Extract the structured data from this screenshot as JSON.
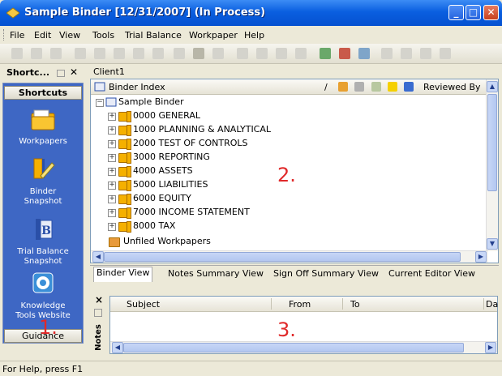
{
  "window": {
    "title": "Sample Binder  [12/31/2007] (In Process)"
  },
  "menu": [
    "File",
    "Edit",
    "View",
    "Tools",
    "Trial Balance",
    "Workpaper",
    "Help"
  ],
  "shortcuts_panel": {
    "header": "Shortc...",
    "close_glyph": "✕",
    "top_tab": "Shortcuts",
    "bottom_tab": "Guidance",
    "items": [
      {
        "label": "Workpapers",
        "icon": "folder-icon"
      },
      {
        "label": "Binder\nSnapshot",
        "icon": "binder-pencil-icon"
      },
      {
        "label": "Trial Balance\nSnapshot",
        "icon": "trial-balance-icon"
      },
      {
        "label": "Knowledge\nTools Website",
        "icon": "knowledge-globe-icon"
      }
    ]
  },
  "client_label": "Client1",
  "binder_index": {
    "column_title": "Binder Index",
    "slash": "/",
    "reviewed_by": "Reviewed By",
    "root": "Sample Binder",
    "items": [
      "0000 GENERAL",
      "1000 PLANNING & ANALYTICAL",
      "2000 TEST OF CONTROLS",
      "3000 REPORTING",
      "4000 ASSETS",
      "5000 LIABILITIES",
      "6000 EQUITY",
      "7000 INCOME STATEMENT",
      "8000 TAX"
    ],
    "unfiled": "Unfiled Workpapers"
  },
  "view_tabs": [
    "Binder View",
    "Notes Summary View",
    "Sign Off Summary View",
    "Current Editor View"
  ],
  "notes": {
    "side_label": "Notes",
    "side_close": "×",
    "columns": [
      "Subject",
      "From",
      "To",
      "Da"
    ]
  },
  "status": {
    "text": "For Help, press F1"
  },
  "callouts": [
    "1.",
    "2.",
    "3."
  ],
  "colors": {
    "title_bar": "#0A5FE0",
    "shortcuts_bg": "#3E67C4",
    "callout_red": "#E0292A",
    "folder_yellow": "#F5B000"
  }
}
